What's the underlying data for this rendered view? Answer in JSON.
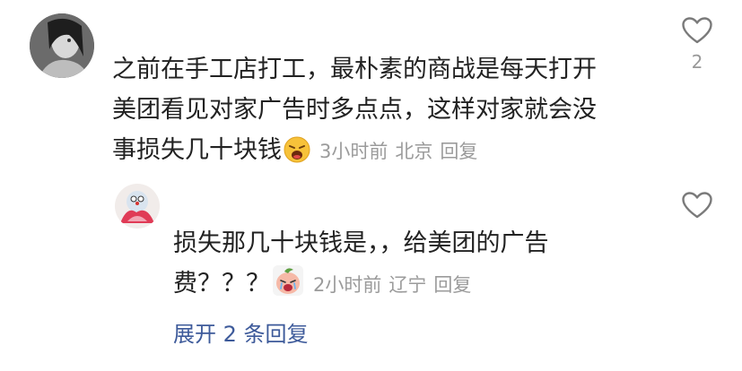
{
  "comments": [
    {
      "text_lines": [
        "之前在手工店打工，最朴素的商战是每天打开",
        "美团看见对家广告时多点点，这样对家就会没",
        "事损失几十块钱"
      ],
      "emoji": "weary-face",
      "time": "3小时前",
      "location": "北京",
      "reply_label": "回复",
      "likes": "2"
    }
  ],
  "reply": {
    "text_lines": [
      "损失那几十块钱是，，给美团的广告",
      "费？？？"
    ],
    "emoji": "crying-peach-sticker",
    "time": "2小时前",
    "location": "辽宁",
    "reply_label": "回复"
  },
  "expand_label": "展开 2 条回复",
  "colors": {
    "text": "#222222",
    "meta": "#9b9b9b",
    "link": "#3d5a9a"
  }
}
